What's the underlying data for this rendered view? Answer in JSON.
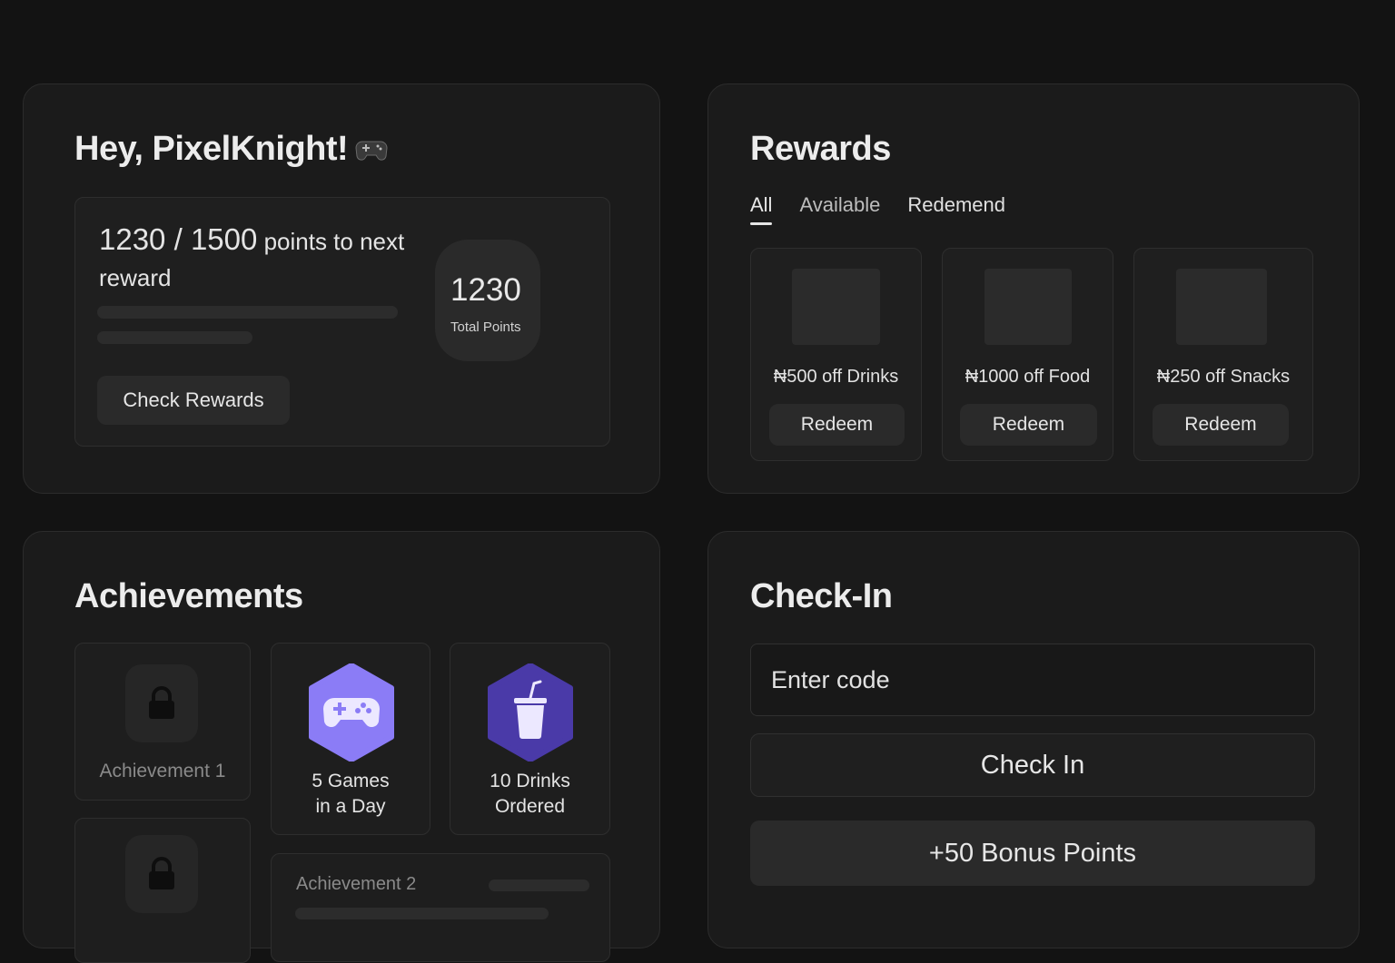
{
  "welcome": {
    "greeting": "Hey, PixelKnight!",
    "greeting_icon": "gamepad-icon",
    "progress_current": "1230",
    "progress_sep": " / ",
    "progress_target": "1500",
    "progress_suffix": " points to next reward",
    "progress_fraction": 0.82,
    "check_rewards_label": "Check Rewards",
    "total_points": "1230",
    "total_points_label": "Total Points"
  },
  "rewards": {
    "title": "Rewards",
    "tabs": [
      {
        "label": "All",
        "active": true
      },
      {
        "label": "Available",
        "active": false
      },
      {
        "label": "Redemend",
        "active": false
      }
    ],
    "items": [
      {
        "label": "₦500 off Drinks",
        "button": "Redeem"
      },
      {
        "label": "₦1000 off Food",
        "button": "Redeem"
      },
      {
        "label": "₦250 off Snacks",
        "button": "Redeem"
      }
    ]
  },
  "achievements": {
    "title": "Achievements",
    "items": [
      {
        "label": "Achievement 1",
        "locked": true,
        "icon": "lock-icon"
      },
      {
        "label_line1": "5 Games",
        "label_line2": "in a Day",
        "locked": false,
        "icon": "gamepad-icon",
        "color": "#8b7cf6"
      },
      {
        "label_line1": "10 Drinks",
        "label_line2": "Ordered",
        "locked": false,
        "icon": "cup-icon",
        "color": "#4a3aa8"
      },
      {
        "label": "",
        "locked": true,
        "icon": "lock-icon"
      },
      {
        "label": "Achievement 2",
        "locked": true
      }
    ]
  },
  "checkin": {
    "title": "Check-In",
    "code_placeholder": "Enter code",
    "check_in_label": "Check In",
    "bonus_label": "+50 Bonus Points"
  },
  "colors": {
    "background": "#131313",
    "panel": "#1b1b1b",
    "accent_purple": "#8b7cf6",
    "accent_deep_purple": "#4a3aa8"
  }
}
